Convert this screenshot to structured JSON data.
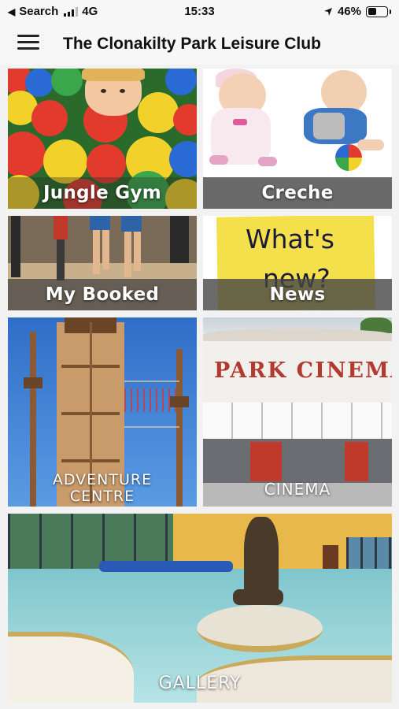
{
  "status_bar": {
    "back_label": "Search",
    "network": "4G",
    "time": "15:33",
    "battery": "46%",
    "battery_level": 0.46
  },
  "app_bar": {
    "title": "The Clonakilty Park Leisure Club",
    "menu_icon": "hamburger-menu-icon"
  },
  "tiles": {
    "jungle_gym": {
      "label": "Jungle Gym"
    },
    "creche": {
      "label": "Creche"
    },
    "booked_classes": {
      "label": "My Booked Classes"
    },
    "news": {
      "label": "News",
      "sign_line1": "What's",
      "sign_line2": "new?"
    },
    "adventure": {
      "label_line1": "ADVENTURE",
      "label_line2": "CENTRE"
    },
    "cinema": {
      "label": "CINEMA",
      "sign": "PARK CINEMA"
    },
    "gallery": {
      "label": "GALLERY"
    }
  },
  "colors": {
    "band": "#505050",
    "sky": "#3c7fd6",
    "sticky_note": "#f4e04a",
    "cinema_red": "#b33a30",
    "pool": "#8fd3d6"
  }
}
